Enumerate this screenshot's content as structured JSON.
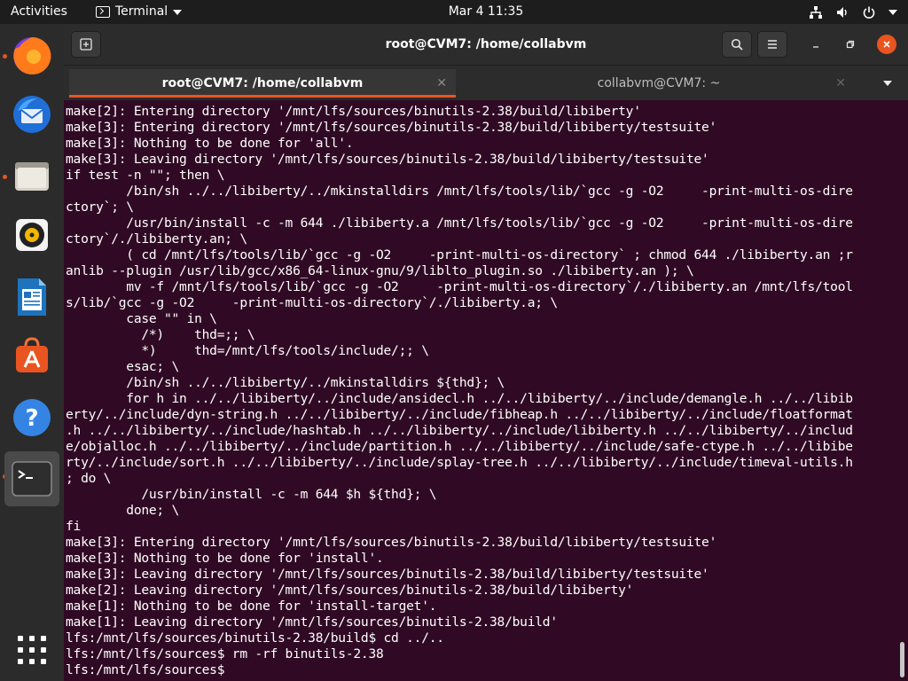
{
  "topbar": {
    "activities": "Activities",
    "app_menu": "Terminal",
    "clock": "Mar 4  11:35",
    "tray_icons": [
      "network-icon",
      "volume-icon",
      "power-icon",
      "chevron-down-icon"
    ]
  },
  "dock": {
    "apps": [
      "Firefox",
      "Thunderbird",
      "Files",
      "Rhythmbox",
      "LibreOffice Writer",
      "Ubuntu Software",
      "Help",
      "Terminal",
      "Show Applications"
    ]
  },
  "window": {
    "title": "root@CVM7: /home/collabvm",
    "tabs": [
      {
        "label": "root@CVM7: /home/collabvm",
        "active": true
      },
      {
        "label": "collabvm@CVM7: ~",
        "active": false
      }
    ]
  },
  "colors": {
    "terminal_bg": "#300a24",
    "accent": "#e95420",
    "headerbar": "#2c2c2c",
    "topbar": "#1d1d1d",
    "dock": "#2b2b2b"
  },
  "terminal": {
    "lines": [
      "make[2]: Entering directory '/mnt/lfs/sources/binutils-2.38/build/libiberty'",
      "make[3]: Entering directory '/mnt/lfs/sources/binutils-2.38/build/libiberty/testsuite'",
      "make[3]: Nothing to be done for 'all'.",
      "make[3]: Leaving directory '/mnt/lfs/sources/binutils-2.38/build/libiberty/testsuite'",
      "if test -n \"\"; then \\",
      "        /bin/sh ../../libiberty/../mkinstalldirs /mnt/lfs/tools/lib/`gcc -g -O2     -print-multi-os-dire",
      "ctory`; \\",
      "        /usr/bin/install -c -m 644 ./libiberty.a /mnt/lfs/tools/lib/`gcc -g -O2     -print-multi-os-dire",
      "ctory`/./libiberty.an; \\",
      "        ( cd /mnt/lfs/tools/lib/`gcc -g -O2     -print-multi-os-directory` ; chmod 644 ./libiberty.an ;r",
      "anlib --plugin /usr/lib/gcc/x86_64-linux-gnu/9/liblto_plugin.so ./libiberty.an ); \\",
      "        mv -f /mnt/lfs/tools/lib/`gcc -g -O2     -print-multi-os-directory`/./libiberty.an /mnt/lfs/tool",
      "s/lib/`gcc -g -O2     -print-multi-os-directory`/./libiberty.a; \\",
      "        case \"\" in \\",
      "          /*)    thd=;; \\",
      "          *)     thd=/mnt/lfs/tools/include/;; \\",
      "        esac; \\",
      "        /bin/sh ../../libiberty/../mkinstalldirs ${thd}; \\",
      "        for h in ../../libiberty/../include/ansidecl.h ../../libiberty/../include/demangle.h ../../libib",
      "erty/../include/dyn-string.h ../../libiberty/../include/fibheap.h ../../libiberty/../include/floatformat",
      ".h ../../libiberty/../include/hashtab.h ../../libiberty/../include/libiberty.h ../../libiberty/../includ",
      "e/objalloc.h ../../libiberty/../include/partition.h ../../libiberty/../include/safe-ctype.h ../../libibe",
      "rty/../include/sort.h ../../libiberty/../include/splay-tree.h ../../libiberty/../include/timeval-utils.h",
      "; do \\",
      "          /usr/bin/install -c -m 644 $h ${thd}; \\",
      "        done; \\",
      "fi",
      "make[3]: Entering directory '/mnt/lfs/sources/binutils-2.38/build/libiberty/testsuite'",
      "make[3]: Nothing to be done for 'install'.",
      "make[3]: Leaving directory '/mnt/lfs/sources/binutils-2.38/build/libiberty/testsuite'",
      "make[2]: Leaving directory '/mnt/lfs/sources/binutils-2.38/build/libiberty'",
      "make[1]: Nothing to be done for 'install-target'.",
      "make[1]: Leaving directory '/mnt/lfs/sources/binutils-2.38/build'",
      "lfs:/mnt/lfs/sources/binutils-2.38/build$ cd ../..",
      "lfs:/mnt/lfs/sources$ rm -rf binutils-2.38",
      "lfs:/mnt/lfs/sources$ "
    ]
  }
}
